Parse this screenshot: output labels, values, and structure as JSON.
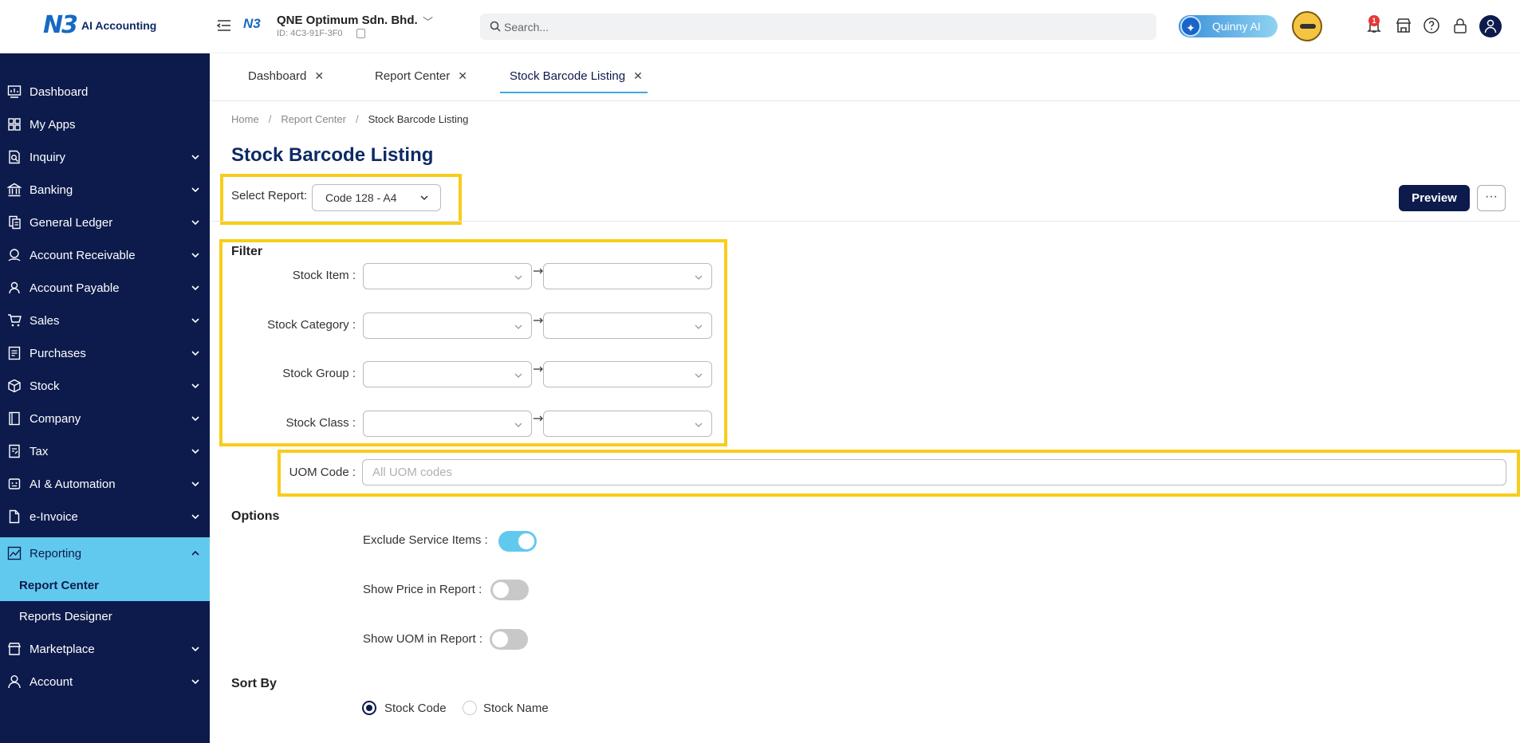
{
  "app": {
    "logo_mark": "N3",
    "logo_text": "AI Accounting"
  },
  "company": {
    "logo_mark": "N3",
    "name": "QNE Optimum Sdn. Bhd.",
    "id": "ID: 4C3-91F-3F0"
  },
  "search": {
    "placeholder": "Search..."
  },
  "quinny": {
    "label": "Quinny AI"
  },
  "notifications": {
    "count": "1"
  },
  "sidebar": {
    "items": [
      {
        "label": "Dashboard",
        "icon": "dashboard-icon"
      },
      {
        "label": "My Apps",
        "icon": "apps-grid-icon"
      },
      {
        "label": "Inquiry",
        "icon": "inquiry-icon"
      },
      {
        "label": "Banking",
        "icon": "bank-icon"
      },
      {
        "label": "General Ledger",
        "icon": "ledger-icon"
      },
      {
        "label": "Account Receivable",
        "icon": "receivable-icon"
      },
      {
        "label": "Account Payable",
        "icon": "payable-icon"
      },
      {
        "label": "Sales",
        "icon": "cart-icon"
      },
      {
        "label": "Purchases",
        "icon": "purchases-icon"
      },
      {
        "label": "Stock",
        "icon": "box-icon"
      },
      {
        "label": "Company",
        "icon": "company-icon"
      },
      {
        "label": "Tax",
        "icon": "tax-icon"
      },
      {
        "label": "AI & Automation",
        "icon": "robot-icon"
      },
      {
        "label": "e-Invoice",
        "icon": "document-icon"
      },
      {
        "label": "Reporting",
        "icon": "chart-icon"
      },
      {
        "label": "Marketplace",
        "icon": "store-icon"
      },
      {
        "label": "Account",
        "icon": "user-icon"
      }
    ],
    "sub_items": [
      {
        "label": "Report Center"
      },
      {
        "label": "Reports Designer"
      }
    ]
  },
  "tabs": [
    {
      "label": "Dashboard"
    },
    {
      "label": "Report Center"
    },
    {
      "label": "Stock Barcode Listing"
    }
  ],
  "breadcrumb": [
    "Home",
    "Report Center",
    "Stock Barcode Listing"
  ],
  "page": {
    "title": "Stock Barcode Listing",
    "select_report_label": "Select Report:",
    "select_report_value": "Code 128 - A4",
    "preview_label": "Preview",
    "more_label": "···"
  },
  "filter": {
    "title": "Filter",
    "fields": [
      {
        "label": "Stock Item :"
      },
      {
        "label": "Stock Category :"
      },
      {
        "label": "Stock Group :"
      },
      {
        "label": "Stock Class :"
      }
    ],
    "uom_label": "UOM Code :",
    "uom_placeholder": "All UOM codes"
  },
  "options": {
    "title": "Options",
    "items": [
      {
        "label": "Exclude Service Items :",
        "on": true
      },
      {
        "label": "Show Price in Report :",
        "on": false
      },
      {
        "label": "Show UOM in Report :",
        "on": false
      }
    ]
  },
  "sort": {
    "title": "Sort By",
    "choices": [
      {
        "label": "Stock Code",
        "checked": true
      },
      {
        "label": "Stock Name",
        "checked": false
      }
    ]
  },
  "colors": {
    "sidebar_bg": "#0d1b4c",
    "active_bg": "#62c9ee",
    "highlight": "#f7cd1b",
    "title": "#0d2a66"
  }
}
